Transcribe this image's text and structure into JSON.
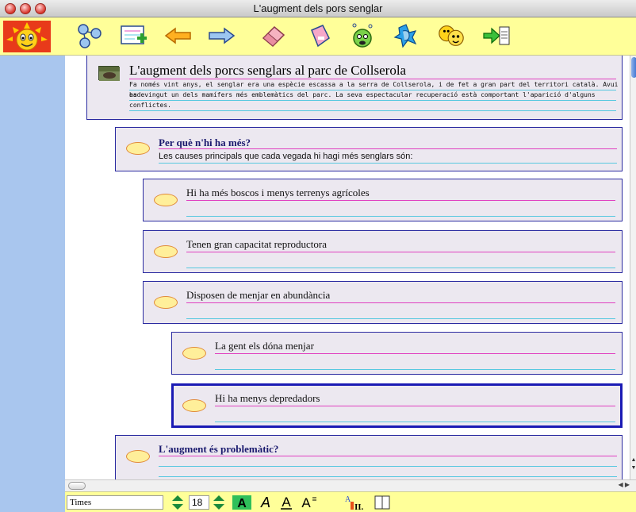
{
  "window": {
    "title": "L'augment dels pors senglar"
  },
  "toolbar": {
    "tools": [
      {
        "name": "concept-map-icon"
      },
      {
        "name": "add-note-icon"
      },
      {
        "name": "arrow-left-icon"
      },
      {
        "name": "arrow-right-icon"
      },
      {
        "name": "eraser-icon"
      },
      {
        "name": "bottle-icon"
      },
      {
        "name": "idea-face-icon"
      },
      {
        "name": "ear-icon"
      },
      {
        "name": "faces-icon"
      },
      {
        "name": "export-icon"
      }
    ]
  },
  "document": {
    "title": "L'augment dels porcs senglars al parc de Collserola",
    "intro_line1": "Fa només vint anys, el senglar era una espècie escassa a la serra de Collserola, i de fet a gran part del territori català. Avui ha",
    "intro_line2": "esdevingut un dels mamífers més emblemàtics del parc. La seva espectacular recuperació està comportant l'aparició d'alguns",
    "intro_line3": "conflictes.",
    "section1": {
      "heading": "Per què n'hi ha més?",
      "body": "Les causes principals que cada vegada hi hagi més senglars són:"
    },
    "causes": [
      "Hi ha més boscos i menys terrenys agrícoles",
      "Tenen gran capacitat reproductora",
      "Disposen de menjar en abundància",
      "La gent els dóna menjar",
      "Hi ha menys depredadors"
    ],
    "section2": {
      "heading": "L'augment és problemàtic?"
    }
  },
  "formatbar": {
    "font_name": "Times",
    "font_size": "18"
  }
}
